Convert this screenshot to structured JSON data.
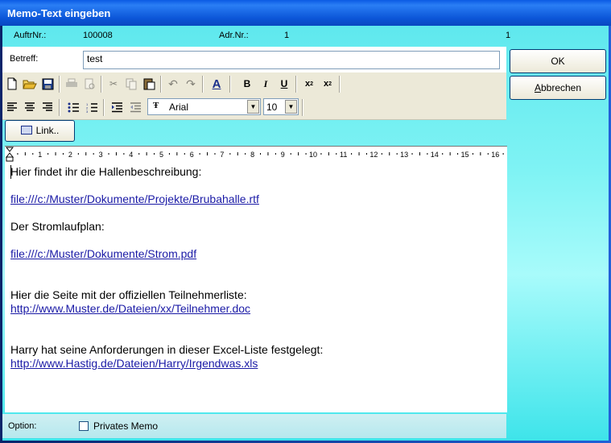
{
  "window": {
    "title": "Memo-Text eingeben"
  },
  "info": {
    "auftr_label": "AuftrNr.:",
    "auftr_value": "100008",
    "adr_label": "Adr.Nr.:",
    "adr_value": "1",
    "right_value": "1"
  },
  "betreff": {
    "label": "Betreff:",
    "value": "test"
  },
  "buttons": {
    "ok": "OK",
    "cancel": "Abbrechen",
    "link": "Link.."
  },
  "format": {
    "font": "Arial",
    "size": "10"
  },
  "ruler": {
    "labels": [
      "1",
      "2",
      "3",
      "4",
      "5",
      "6",
      "7",
      "8",
      "9",
      "10",
      "11",
      "12",
      "13",
      "14",
      "15",
      "16"
    ]
  },
  "editor": {
    "lines": [
      {
        "text": "Hier findet ihr die Hallenbeschreibung:",
        "link": false
      },
      {
        "text": "file:///c:/Muster/Dokumente/Projekte/Brubahalle.rtf",
        "link": true
      },
      {
        "text": "Der Stromlaufplan:",
        "link": false
      },
      {
        "text": "file:///c:/Muster/Dokumente/Strom.pdf",
        "link": true
      },
      {
        "text": "Hier die Seite mit der offiziellen Teilnehmerliste:",
        "link": false
      },
      {
        "text": "http://www.Muster.de/Dateien/xx/Teilnehmer.doc",
        "link": true
      },
      {
        "text": "Harry hat seine Anforderungen in dieser Excel-Liste festgelegt:",
        "link": false
      },
      {
        "text": "http://www.Hastig.de/Dateien/Harry/Irgendwas.xls",
        "link": true
      }
    ]
  },
  "option": {
    "label": "Option:",
    "checkbox_label": "Privates Memo",
    "checked": false
  },
  "icons": [
    "new-document-icon",
    "open-folder-icon",
    "save-icon",
    "print-icon",
    "print-preview-icon",
    "cut-icon",
    "copy-icon",
    "paste-icon",
    "undo-icon",
    "redo-icon",
    "font-color-icon",
    "bold-icon",
    "italic-icon",
    "underline-icon",
    "subscript-icon",
    "superscript-icon",
    "align-left-icon",
    "align-center-icon",
    "align-right-icon",
    "bullet-list-icon",
    "numbered-list-icon",
    "indent-icon",
    "outdent-icon",
    "truetype-font-icon"
  ],
  "colors": {
    "title_bar": "#0c56d8",
    "client_gradient": "#7ff3f4",
    "link": "#1a1aa6"
  }
}
